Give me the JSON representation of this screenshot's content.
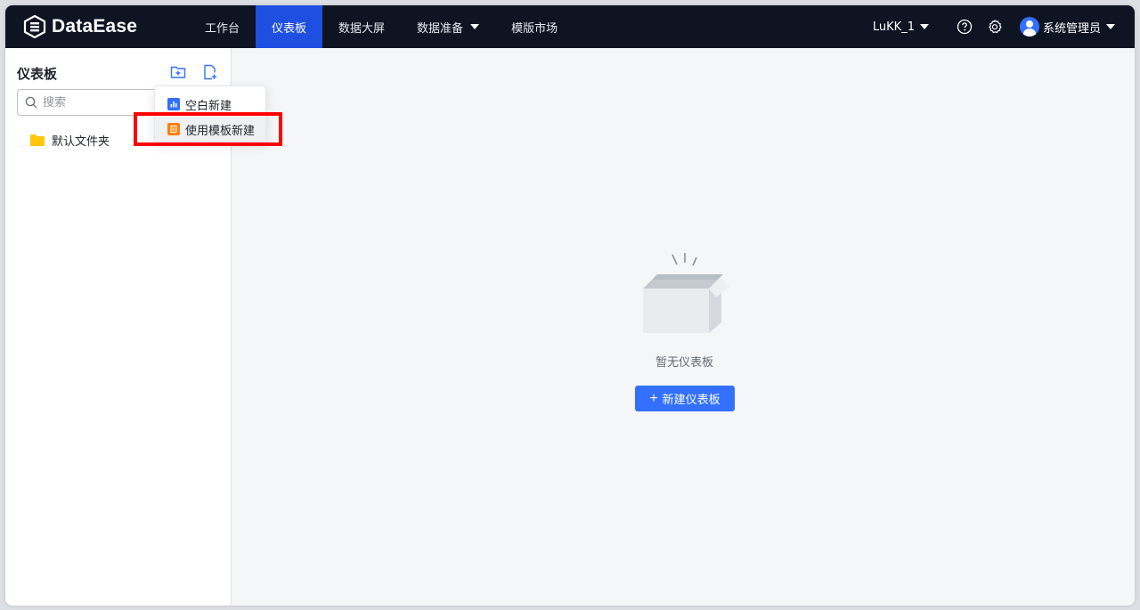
{
  "app": {
    "logo_text": "DataEase"
  },
  "nav": {
    "tabs": [
      {
        "label": "工作台"
      },
      {
        "label": "仪表板",
        "active": true
      },
      {
        "label": "数据大屏"
      },
      {
        "label": "数据准备",
        "has_dropdown": true
      },
      {
        "label": "模版市场"
      }
    ]
  },
  "header_right": {
    "workspace": "LuKK_1",
    "help_icon": "help-circle-icon",
    "settings_icon": "gear-icon",
    "user_name": "系统管理员"
  },
  "sidebar": {
    "title": "仪表板",
    "new_folder_icon": "folder-plus-icon",
    "new_file_icon": "file-plus-icon",
    "search_placeholder": "搜索",
    "tree": [
      {
        "label": "默认文件夹",
        "icon": "folder-icon"
      }
    ]
  },
  "dropdown": {
    "items": [
      {
        "label": "空白新建",
        "icon": "blank-dashboard-icon"
      },
      {
        "label": "使用模板新建",
        "icon": "template-icon"
      }
    ]
  },
  "empty_state": {
    "text": "暂无仪表板",
    "button_label": "新建仪表板"
  },
  "colors": {
    "topbar_bg": "#0f1423",
    "active_tab": "#1f4fe0",
    "primary": "#3370ff",
    "folder": "#ffc60a",
    "highlight_box": "#ff0000",
    "main_bg": "#f5f6f7",
    "template_icon": "#ff7d00"
  }
}
